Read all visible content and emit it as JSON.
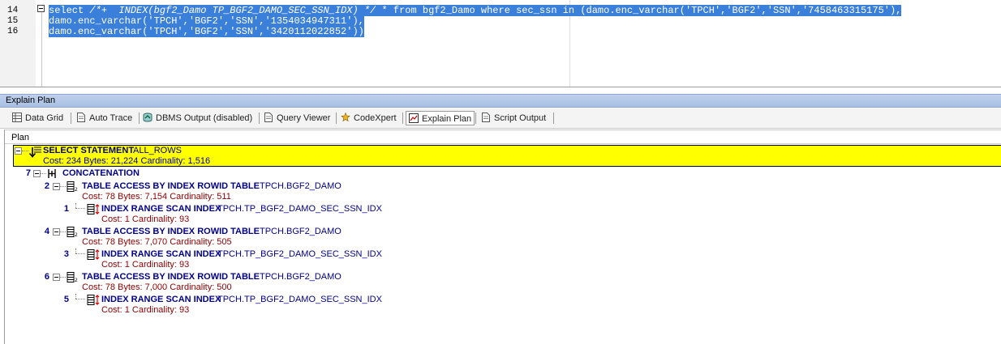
{
  "editor": {
    "lines": [
      {
        "num": "14",
        "text_sel": "select ",
        "text_comment": "/*+  INDEX(bgf2_Damo TP_BGF2_DAMO_SEC_SSN_IDX) */",
        "text_rest": " * from bgf2_Damo where sec_ssn in (damo.enc_varchar('TPCH','BGF2','SSN','7458463315175'),"
      },
      {
        "num": "15",
        "text": "damo.enc_varchar('TPCH','BGF2','SSN','1354034947311'),"
      },
      {
        "num": "16",
        "text": "damo.enc_varchar('TPCH','BGF2','SSN','3420112022852'))"
      }
    ]
  },
  "panel": {
    "title": "Explain Plan"
  },
  "tabs": [
    {
      "label": "Data Grid",
      "icon": "grid-icon"
    },
    {
      "label": "Auto Trace",
      "icon": "document-icon"
    },
    {
      "label": "DBMS Output (disabled)",
      "icon": "dbms-output-icon"
    },
    {
      "label": "Query Viewer",
      "icon": "document-icon"
    },
    {
      "label": "CodeXpert",
      "icon": "codexpert-icon"
    },
    {
      "label": "Explain Plan",
      "icon": "explain-plan-icon",
      "active": true
    },
    {
      "label": "Script Output",
      "icon": "document-icon"
    }
  ],
  "plan": {
    "header": "Plan",
    "root": {
      "operation": "SELECT STATEMENT",
      "object": "ALL_ROWS",
      "cost": "Cost: 234  Bytes: 21,224  Cardinality: 1,516"
    },
    "concat": {
      "step": "7",
      "operation": "CONCATENATION"
    },
    "rows": [
      {
        "step": "2",
        "operation": "TABLE ACCESS BY INDEX ROWID TABLE",
        "object": "TPCH.BGF2_DAMO",
        "cost": "Cost: 78  Bytes: 7,154  Cardinality: 511"
      },
      {
        "step": "1",
        "operation": "INDEX RANGE SCAN INDEX",
        "object": "TPCH.TP_BGF2_DAMO_SEC_SSN_IDX",
        "cost": "Cost: 1  Cardinality: 93"
      },
      {
        "step": "4",
        "operation": "TABLE ACCESS BY INDEX ROWID TABLE",
        "object": "TPCH.BGF2_DAMO",
        "cost": "Cost: 78  Bytes: 7,070  Cardinality: 505"
      },
      {
        "step": "3",
        "operation": "INDEX RANGE SCAN INDEX",
        "object": "TPCH.TP_BGF2_DAMO_SEC_SSN_IDX",
        "cost": "Cost: 1  Cardinality: 93"
      },
      {
        "step": "6",
        "operation": "TABLE ACCESS BY INDEX ROWID TABLE",
        "object": "TPCH.BGF2_DAMO",
        "cost": "Cost: 78  Bytes: 7,000  Cardinality: 500"
      },
      {
        "step": "5",
        "operation": "INDEX RANGE SCAN INDEX",
        "object": "TPCH.TP_BGF2_DAMO_SEC_SSN_IDX",
        "cost": "Cost: 1  Cardinality: 93"
      }
    ]
  },
  "colors": {
    "selection": "#3a7fd9",
    "highlight_row": "#ffff00",
    "plan_text": "#00008b",
    "cost_text": "#8b0000",
    "panel_title": "#bed1ec"
  }
}
